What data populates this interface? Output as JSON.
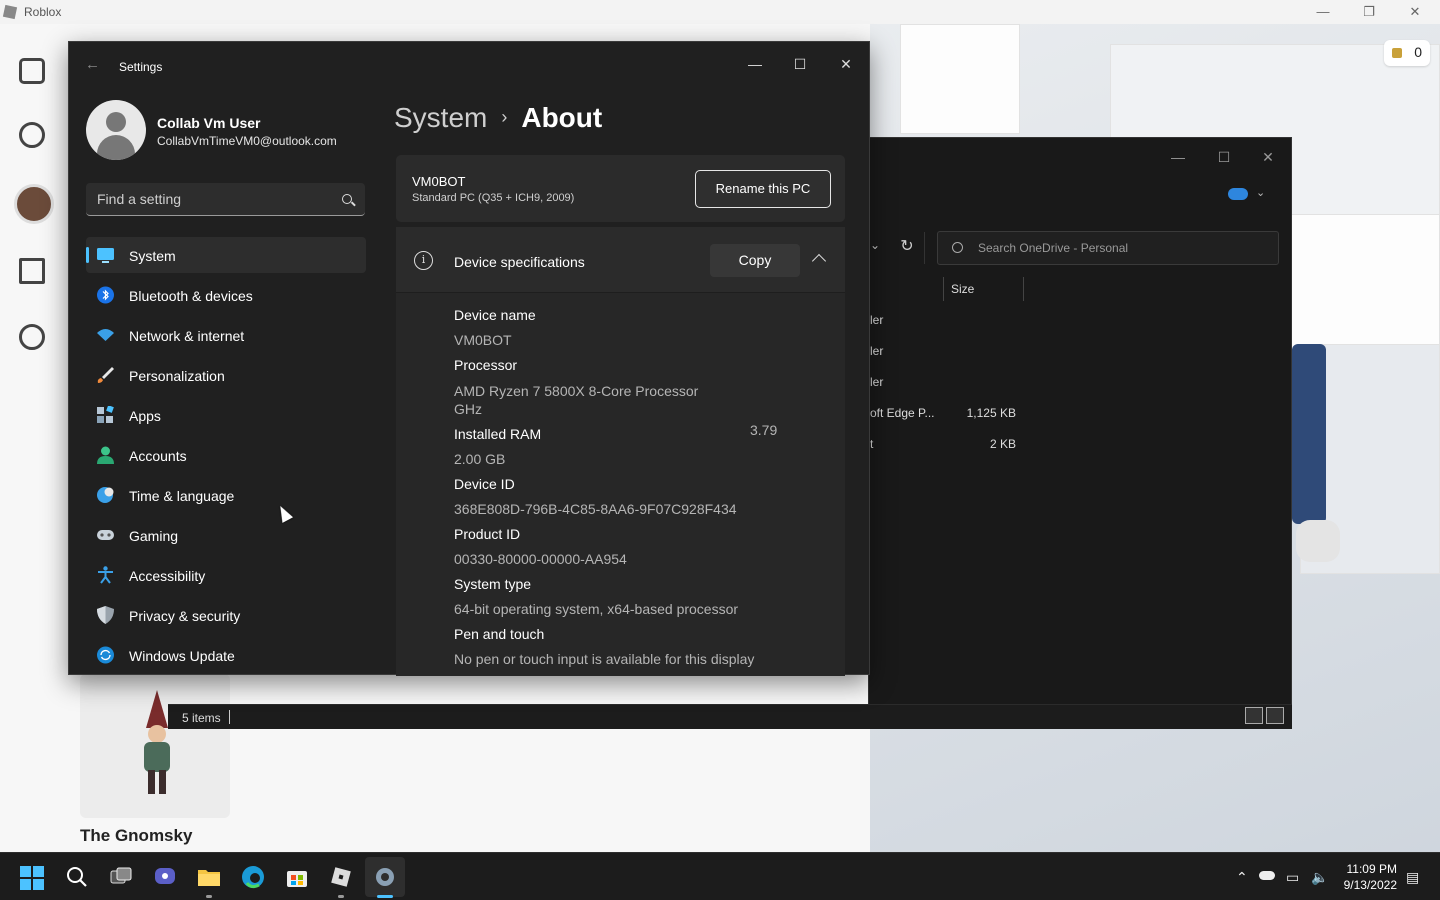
{
  "roblox": {
    "title": "Roblox",
    "robux_balance": "0",
    "featured_item": "The Gnomsky"
  },
  "explorer": {
    "search_placeholder": "Search OneDrive - Personal",
    "column_size": "Size",
    "files": [
      {
        "name": "ler",
        "size": ""
      },
      {
        "name": "ler",
        "size": ""
      },
      {
        "name": "ler",
        "size": ""
      },
      {
        "name": "oft Edge P...",
        "size": "1,125 KB"
      },
      {
        "name": "t",
        "size": "2 KB"
      }
    ],
    "status": "5 items"
  },
  "settings": {
    "window_title": "Settings",
    "user": {
      "name": "Collab Vm User",
      "email": "CollabVmTimeVM0@outlook.com"
    },
    "search_placeholder": "Find a setting",
    "nav": [
      {
        "label": "System",
        "icon": "monitor-icon",
        "active": true
      },
      {
        "label": "Bluetooth & devices",
        "icon": "bluetooth-icon"
      },
      {
        "label": "Network & internet",
        "icon": "wifi-icon"
      },
      {
        "label": "Personalization",
        "icon": "brush-icon"
      },
      {
        "label": "Apps",
        "icon": "apps-icon"
      },
      {
        "label": "Accounts",
        "icon": "person-icon"
      },
      {
        "label": "Time & language",
        "icon": "globe-clock-icon"
      },
      {
        "label": "Gaming",
        "icon": "controller-icon"
      },
      {
        "label": "Accessibility",
        "icon": "accessibility-icon"
      },
      {
        "label": "Privacy & security",
        "icon": "shield-icon"
      },
      {
        "label": "Windows Update",
        "icon": "update-icon"
      }
    ],
    "breadcrumb": {
      "parent": "System",
      "separator": "›",
      "current": "About"
    },
    "pc": {
      "name": "VM0BOT",
      "model": "Standard PC (Q35 + ICH9, 2009)",
      "rename_label": "Rename this PC"
    },
    "specs": {
      "title": "Device specifications",
      "copy_label": "Copy",
      "device_name_label": "Device name",
      "device_name": "VM0BOT",
      "processor_label": "Processor",
      "processor": "AMD Ryzen 7 5800X 8-Core Processor GHz",
      "processor_speed": "3.79",
      "ram_label": "Installed RAM",
      "ram": "2.00 GB",
      "device_id_label": "Device ID",
      "device_id": "368E808D-796B-4C85-8AA6-9F07C928F434",
      "product_id_label": "Product ID",
      "product_id": "00330-80000-00000-AA954",
      "system_type_label": "System type",
      "system_type": "64-bit operating system, x64-based processor",
      "pen_label": "Pen and touch",
      "pen": "No pen or touch input is available for this display"
    }
  },
  "taskbar": {
    "time": "11:09 PM",
    "date": "9/13/2022"
  },
  "colors": {
    "accent": "#4cc2ff",
    "window_bg": "#202020",
    "card_bg": "#2b2b2b"
  }
}
